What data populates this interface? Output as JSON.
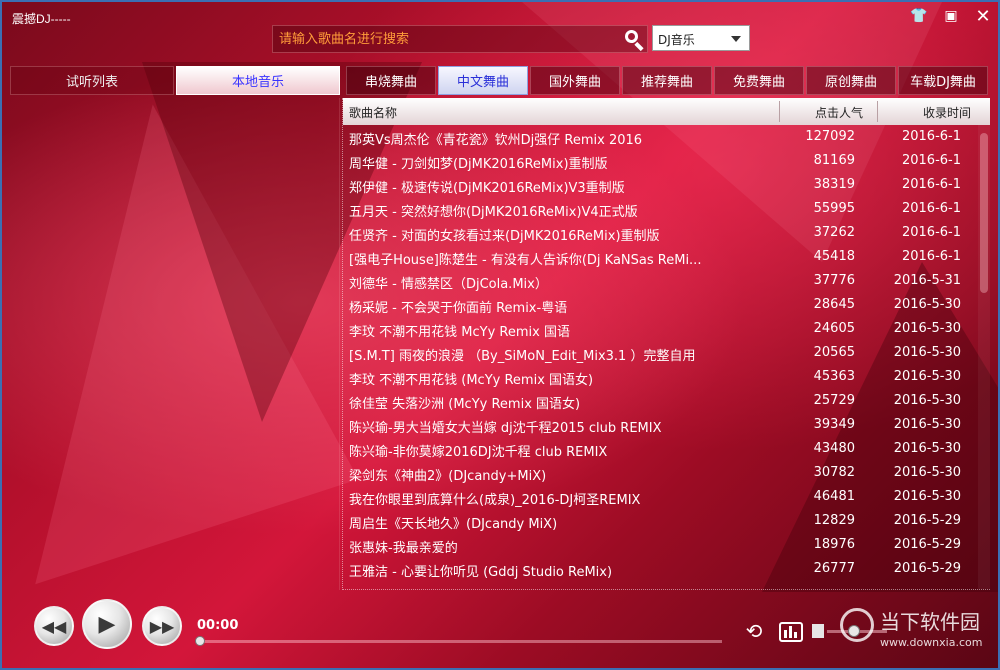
{
  "window": {
    "title": "震撼DJ-----"
  },
  "search": {
    "placeholder": "请输入歌曲名进行搜索",
    "source_selected": "DJ音乐"
  },
  "left_tabs": [
    {
      "label": "试听列表",
      "active": false
    },
    {
      "label": "本地音乐",
      "active": true
    }
  ],
  "category_tabs": [
    {
      "label": "串烧舞曲",
      "active": false
    },
    {
      "label": "中文舞曲",
      "active": true
    },
    {
      "label": "国外舞曲",
      "active": false
    },
    {
      "label": "推荐舞曲",
      "active": false
    },
    {
      "label": "免费舞曲",
      "active": false
    },
    {
      "label": "原创舞曲",
      "active": false
    },
    {
      "label": "车载DJ舞曲",
      "active": false
    }
  ],
  "song_list": {
    "columns": {
      "name": "歌曲名称",
      "hits": "点击人气",
      "date": "收录时间"
    },
    "rows": [
      {
        "name": "那英Vs周杰伦《青花瓷》钦州Dj强仔 Remix 2016",
        "hits": "127092",
        "date": "2016-6-1"
      },
      {
        "name": "周华健 - 刀剑如梦(DjMK2016ReMix)重制版",
        "hits": "81169",
        "date": "2016-6-1"
      },
      {
        "name": "郑伊健 - 极速传说(DjMK2016ReMix)V3重制版",
        "hits": "38319",
        "date": "2016-6-1"
      },
      {
        "name": "五月天 - 突然好想你(DjMK2016ReMix)V4正式版",
        "hits": "55995",
        "date": "2016-6-1"
      },
      {
        "name": "任贤齐 - 对面的女孩看过来(DjMK2016ReMix)重制版",
        "hits": "37262",
        "date": "2016-6-1"
      },
      {
        "name": "[强电子House]陈楚生 - 有没有人告诉你(Dj KaNSas ReMi...",
        "hits": "45418",
        "date": "2016-6-1"
      },
      {
        "name": "刘德华 - 情感禁区（DjCola.Mix）",
        "hits": "37776",
        "date": "2016-5-31"
      },
      {
        "name": "杨采妮 - 不会哭于你面前 Remix-粤语",
        "hits": "28645",
        "date": "2016-5-30"
      },
      {
        "name": "李玟 不潮不用花钱 McYy Remix 国语",
        "hits": "24605",
        "date": "2016-5-30"
      },
      {
        "name": "[S.M.T] 雨夜的浪漫 （By_SiMoN_Edit_Mix3.1 ）完整自用",
        "hits": "20565",
        "date": "2016-5-30"
      },
      {
        "name": "李玟 不潮不用花钱 (McYy Remix 国语女)",
        "hits": "45363",
        "date": "2016-5-30"
      },
      {
        "name": "徐佳莹 失落沙洲 (McYy Remix 国语女)",
        "hits": "25729",
        "date": "2016-5-30"
      },
      {
        "name": "陈兴瑜-男大当婚女大当嫁 dj沈千程2015 club REMIX",
        "hits": "39349",
        "date": "2016-5-30"
      },
      {
        "name": "陈兴瑜-非你莫嫁2016DJ沈千程 club REMIX",
        "hits": "43480",
        "date": "2016-5-30"
      },
      {
        "name": "梁剑东《神曲2》(DJcandy+MiX)",
        "hits": "30782",
        "date": "2016-5-30"
      },
      {
        "name": "我在你眼里到底算什么(成泉)_2016-DJ柯圣REMIX",
        "hits": "46481",
        "date": "2016-5-30"
      },
      {
        "name": "周启生《天长地久》(DJcandy MiX)",
        "hits": "12829",
        "date": "2016-5-29"
      },
      {
        "name": "张惠妹-我最亲爱的",
        "hits": "18976",
        "date": "2016-5-29"
      },
      {
        "name": "王雅洁 - 心要让你听见 (Gddj Studio ReMix)",
        "hits": "26777",
        "date": "2016-5-29"
      }
    ]
  },
  "player": {
    "time": "00:00",
    "progress": 0,
    "volume": 0.45
  },
  "watermark": {
    "name": "当下软件园",
    "url": "www.downxia.com"
  },
  "icons": {
    "skin": "skin-icon",
    "minimize": "minimize-icon",
    "close": "close-icon",
    "search": "search-icon",
    "prev": "previous-icon",
    "play": "play-icon",
    "next": "next-icon",
    "loop": "loop-icon",
    "equalizer": "equalizer-icon",
    "volume": "volume-icon"
  },
  "colors": {
    "accent": "#d3163a",
    "active_tab_text": "#2a30d8",
    "search_placeholder": "#ff9c3a"
  }
}
